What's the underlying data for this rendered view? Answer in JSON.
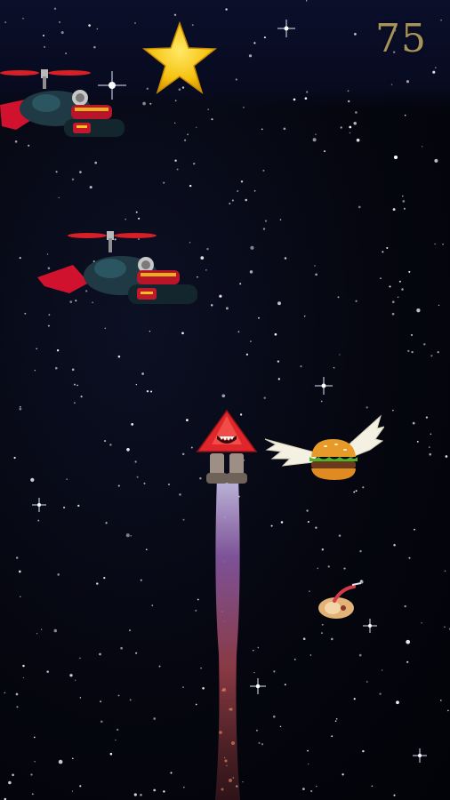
{
  "game": {
    "score": "75"
  },
  "hud": {
    "star_icon": "gold-star-icon"
  },
  "sprites": [
    "helicopter-hero-enemy",
    "helicopter-hero-enemy",
    "rocket-player-ship",
    "flying-burger-pickup",
    "space-hotdog-pickup"
  ],
  "colors": {
    "background": "#05060d",
    "score_text": "#a8925c",
    "star_gold": "#f6c20f",
    "rocket_red": "#e0262a",
    "rotor_red": "#d91f26",
    "cape_red": "#d1122e",
    "exhaust": "#8a5aa6"
  }
}
